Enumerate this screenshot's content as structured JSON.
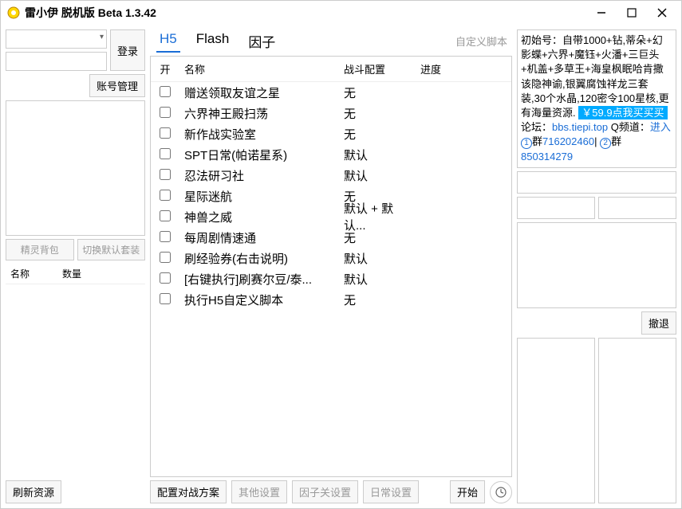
{
  "window": {
    "title": "雷小伊 脱机版 Beta 1.3.42"
  },
  "left": {
    "login_btn": "登录",
    "account_mgr": "账号管理",
    "spirit_bag": "精灵背包",
    "switch_default": "切换默认套装",
    "col_name": "名称",
    "col_qty": "数量",
    "refresh": "刷新资源"
  },
  "tabs": {
    "h5": "H5",
    "flash": "Flash",
    "factor": "因子",
    "custom": "自定义脚本"
  },
  "task_hdr": {
    "chk": "开",
    "name": "名称",
    "battle": "战斗配置",
    "prog": "进度"
  },
  "tasks": [
    {
      "name": "赠送领取友谊之星",
      "battle": "无"
    },
    {
      "name": "六界神王殿扫荡",
      "battle": "无"
    },
    {
      "name": "新作战实验室",
      "battle": "无"
    },
    {
      "name": "SPT日常(帕诺星系)",
      "battle": "默认"
    },
    {
      "name": "忍法研习社",
      "battle": "默认"
    },
    {
      "name": "星际迷航",
      "battle": "无"
    },
    {
      "name": "神兽之威",
      "battle": "默认 + 默认..."
    },
    {
      "name": "每周剧情速通",
      "battle": "无"
    },
    {
      "name": "刷经验券(右击说明)",
      "battle": "默认"
    },
    {
      "name": "[右键执行]刷赛尔豆/泰...",
      "battle": "默认"
    },
    {
      "name": "执行H5自定义脚本",
      "battle": "无"
    }
  ],
  "bottom": {
    "config_battle": "配置对战方案",
    "other": "其他设置",
    "factor": "因子关设置",
    "daily": "日常设置",
    "start": "开始"
  },
  "right": {
    "promo_text": "初始号：自带1000+钻,蒂朵+幻影蝶+六界+魔钰+火潘+三巨头+机盖+多草王+海皇枫眠哈肯撒该隐神谕,银翼腐蚀祥龙三套装,30个水晶,120密令100星核,更有海量资源.",
    "promo_price": "￥59.9点我买买买",
    "forum_label": "论坛：",
    "forum_link": "bbs.tiepi.top",
    "channel_label": " Q频道：",
    "channel_link": "进入",
    "group1_label": "群",
    "group1": "716202460",
    "group2_label": "群",
    "group2": "850314279",
    "retreat": "撤退"
  }
}
